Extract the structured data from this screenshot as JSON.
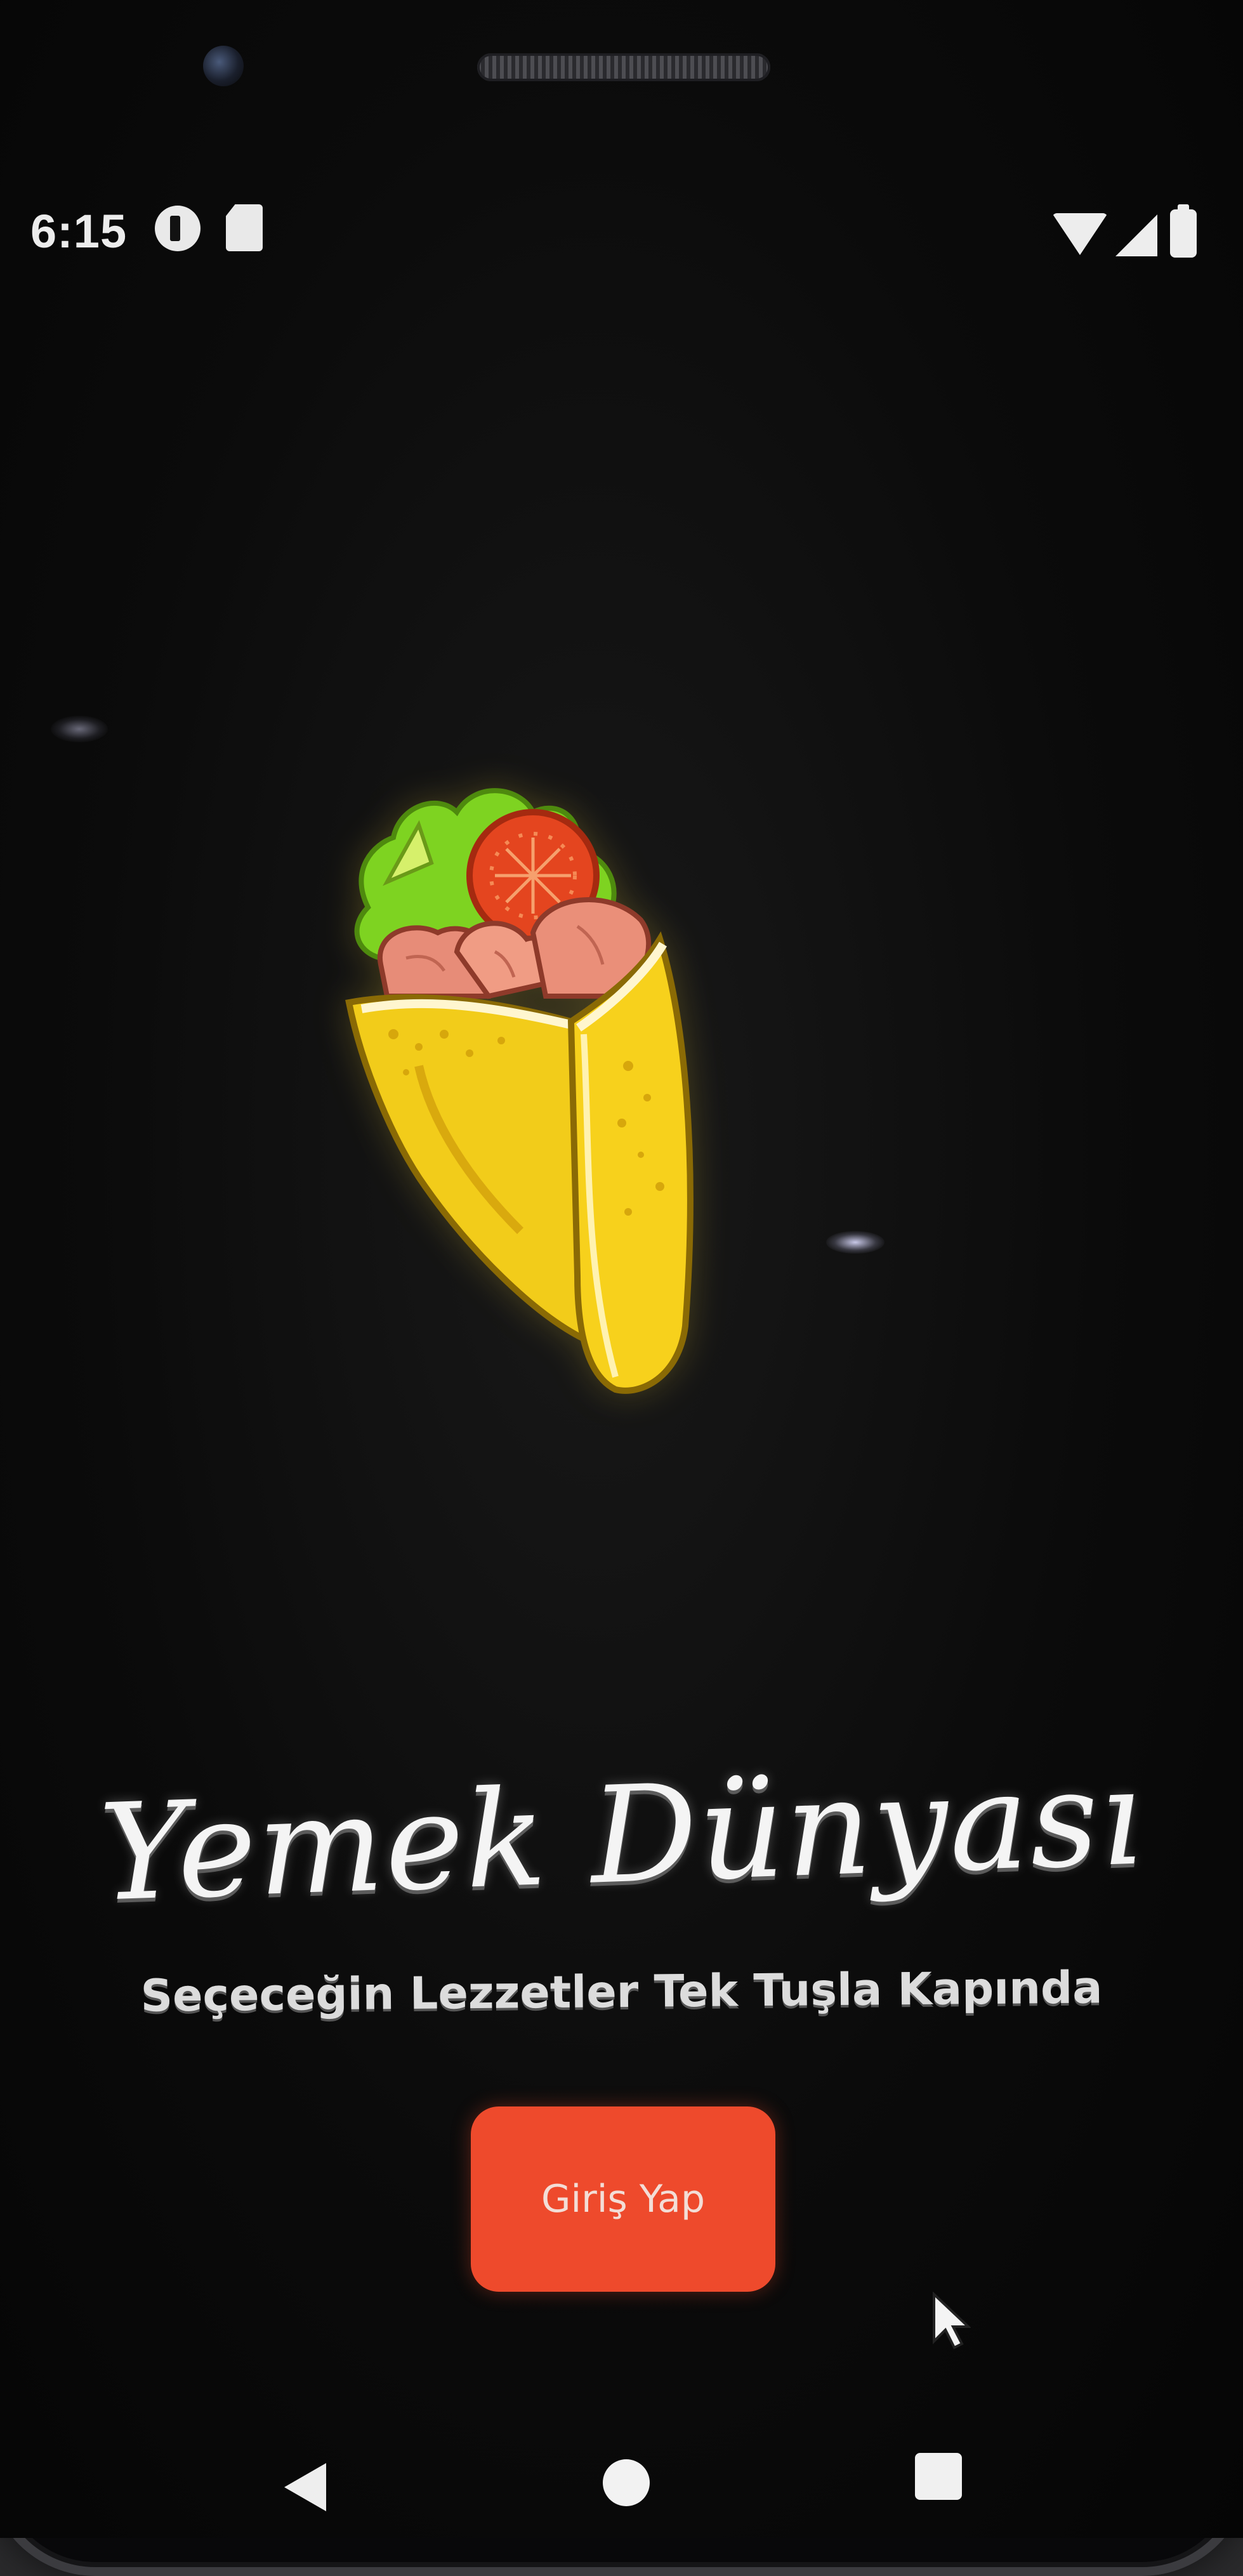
{
  "status_bar": {
    "time": "6:15",
    "left_icons": [
      "notification-circle-icon",
      "sd-card-icon"
    ],
    "right_icons": [
      "wifi-icon",
      "signal-icon",
      "battery-icon"
    ]
  },
  "splash": {
    "illustration": "wrap-sandwich-illustration",
    "title": "Yemek Dünyası",
    "subtitle": "Seçeceğin Lezzetler Tek Tuşla Kapında",
    "login_button_label": "Giriş Yap"
  },
  "nav_bar": {
    "icons": [
      "back-icon",
      "home-icon",
      "recents-icon"
    ]
  },
  "colors": {
    "background": "#0b0b0b",
    "login_button": "#ee4a2c",
    "title_text": "#f4f4f4"
  }
}
